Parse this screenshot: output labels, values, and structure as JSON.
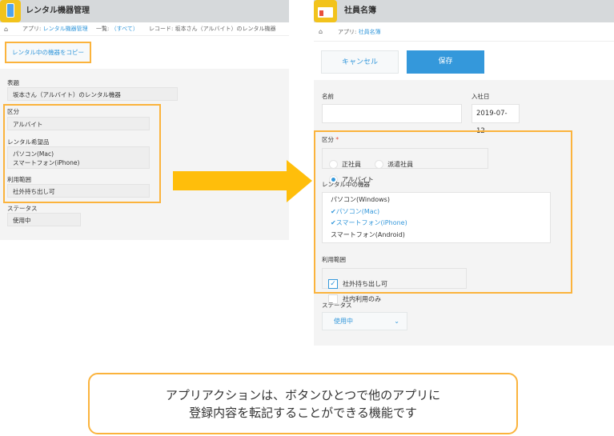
{
  "left_app": {
    "title": "レンタル機器管理",
    "icon": "smartphone-icon",
    "breadcrumb": {
      "app_prefix": "アプリ: ",
      "app_name": "レンタル機器管理",
      "list_prefix": "一覧: ",
      "list_name": "（すべて）",
      "record": "レコード: 坂本さん（アルバイト）のレンタル機器"
    },
    "copy_button": "レンタル中の機器をコピー",
    "fields": {
      "title_label": "表題",
      "title_value": "坂本さん（アルバイト）のレンタル機器",
      "category_label": "区分",
      "category_value": "アルバイト",
      "wanted_label": "レンタル希望品",
      "wanted_values": [
        "パソコン(Mac)",
        "スマートフォン(iPhone)"
      ],
      "scope_label": "利用範囲",
      "scope_value": "社外持ち出し可",
      "status_label": "ステータス",
      "status_value": "使用中"
    }
  },
  "right_app": {
    "title": "社員名簿",
    "icon": "id-card-icon",
    "breadcrumb": {
      "app_prefix": "アプリ: ",
      "app_name": "社員名簿"
    },
    "cancel_button": "キャンセル",
    "save_button": "保存",
    "fields": {
      "name_label": "名前",
      "name_value": "",
      "join_label": "入社日",
      "join_value": "2019-07-12",
      "category_label": "区分",
      "required_mark": "*",
      "category_options": [
        {
          "label": "正社員",
          "selected": false
        },
        {
          "label": "派遣社員",
          "selected": false
        },
        {
          "label": "アルバイト",
          "selected": true
        }
      ],
      "devices_label": "レンタル中の機器",
      "devices": [
        {
          "label": "パソコン(Windows)",
          "selected": false
        },
        {
          "label": "パソコン(Mac)",
          "selected": true
        },
        {
          "label": "スマートフォン(iPhone)",
          "selected": true
        },
        {
          "label": "スマートフォン(Android)",
          "selected": false
        }
      ],
      "scope_label": "利用範囲",
      "scope_options": [
        {
          "label": "社外持ち出し可",
          "checked": true
        },
        {
          "label": "社内利用のみ",
          "checked": false
        }
      ],
      "status_label": "ステータス",
      "status_value": "使用中"
    }
  },
  "caption": {
    "line1": "アプリアクションは、ボタンひとつで他のアプリに",
    "line2": "登録内容を転記することができる機能です"
  },
  "colors": {
    "highlight": "#fbb33c",
    "arrow": "#ffbe0b",
    "accent": "#3498db"
  }
}
